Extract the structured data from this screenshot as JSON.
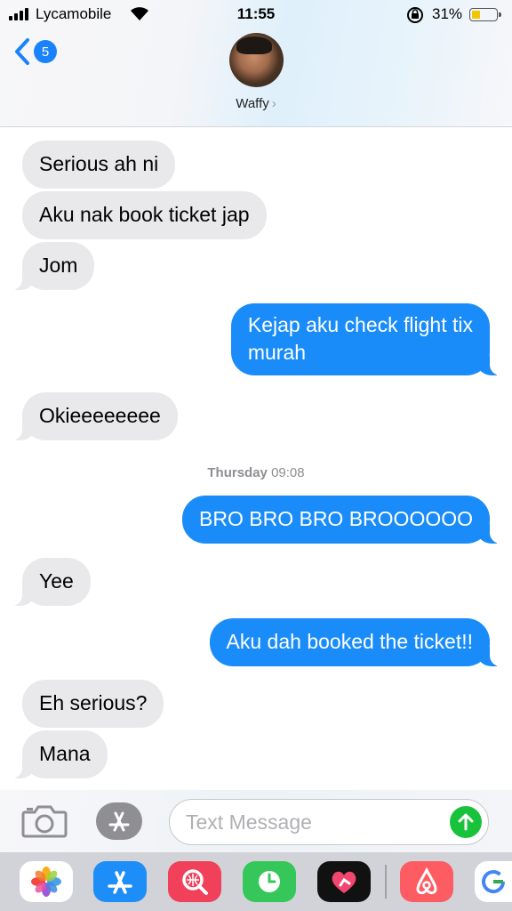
{
  "status_bar": {
    "carrier": "Lycamobile",
    "time": "11:55",
    "battery_pct": "31%"
  },
  "header": {
    "back_count": "5",
    "contact_name": "Waffy",
    "chevron": "›"
  },
  "messages": [
    {
      "side": "in",
      "text": "Serious ah ni"
    },
    {
      "side": "in",
      "text": "Aku nak book ticket jap"
    },
    {
      "side": "in",
      "text": "Jom"
    },
    {
      "side": "out",
      "text_line1": "Kejap aku check flight tix",
      "text_line2": "murah"
    },
    {
      "side": "in",
      "text": "Okieeeeeeee"
    },
    {
      "side": "out",
      "text": "BRO BRO BRO BROOOOOO"
    },
    {
      "side": "in",
      "text": "Yee"
    },
    {
      "side": "out",
      "text": "Aku dah booked the ticket!!"
    },
    {
      "side": "in",
      "text": "Eh serious?"
    },
    {
      "side": "in",
      "text": "Mana"
    }
  ],
  "timestamp": {
    "day": "Thursday",
    "time": "09:08"
  },
  "composer": {
    "placeholder": "Text Message"
  },
  "drawer": {
    "apps": [
      "photos-icon",
      "app-store-icon",
      "search-images-icon",
      "activity-icon",
      "digital-touch-icon",
      "airbnb-icon",
      "google-icon"
    ]
  },
  "colors": {
    "outgoing": "#1a8cf9",
    "incoming": "#e9e9eb",
    "send": "#19c23b",
    "link_blue": "#1a82fb"
  }
}
